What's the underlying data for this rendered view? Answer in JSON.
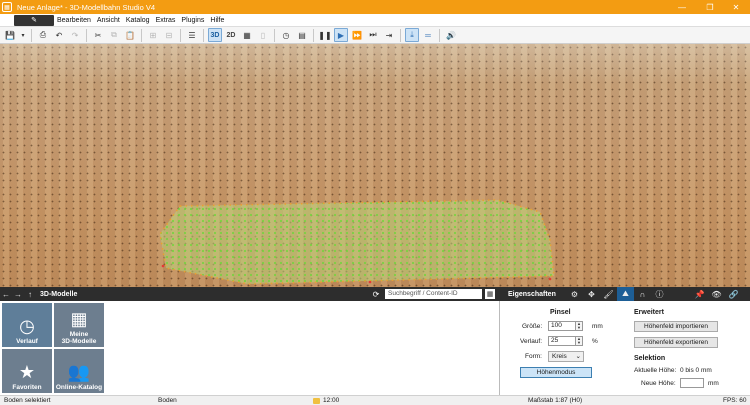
{
  "window": {
    "title": "Neue Anlage* - 3D-Modellbahn Studio V4",
    "accent": "#f39c12"
  },
  "menu": {
    "items": [
      "Bearbeiten",
      "Ansicht",
      "Katalog",
      "Extras",
      "Plugins",
      "Hilfe"
    ]
  },
  "toolbar": {
    "view_3d": "3D",
    "view_2d": "2D"
  },
  "catalog": {
    "title": "3D-Modelle",
    "search_placeholder": "Suchbegriff / Content-ID",
    "tiles": [
      {
        "label": "Verlauf",
        "icon": "clock-icon"
      },
      {
        "label": "Meine 3D-Modelle",
        "icon": "grid-icon"
      },
      {
        "label": "Favoriten",
        "icon": "star-icon"
      },
      {
        "label": "Online-Katalog",
        "icon": "people-icon"
      }
    ]
  },
  "properties": {
    "title": "Eigenschaften",
    "pinsel": {
      "heading": "Pinsel",
      "groesse_label": "Größe:",
      "groesse_value": "100",
      "groesse_unit": "mm",
      "verlauf_label": "Verlauf:",
      "verlauf_value": "25",
      "verlauf_unit": "%",
      "form_label": "Form:",
      "form_value": "Kreis",
      "mode_button": "Höhenmodus"
    },
    "erweitert": {
      "heading": "Erweitert",
      "import_button": "Höhenfeld importieren",
      "export_button": "Höhenfeld exportieren"
    },
    "selektion": {
      "heading": "Selektion",
      "current_height_label": "Aktuelle Höhe:",
      "current_height_value": "0 bis 0 mm",
      "new_height_label": "Neue Höhe:",
      "new_height_value": "",
      "new_height_unit": "mm"
    }
  },
  "status": {
    "left": "Boden selektiert",
    "object": "Boden",
    "time": "12:00",
    "scale": "Maßstab 1:87 (H0)",
    "fps": "FPS: 60"
  }
}
